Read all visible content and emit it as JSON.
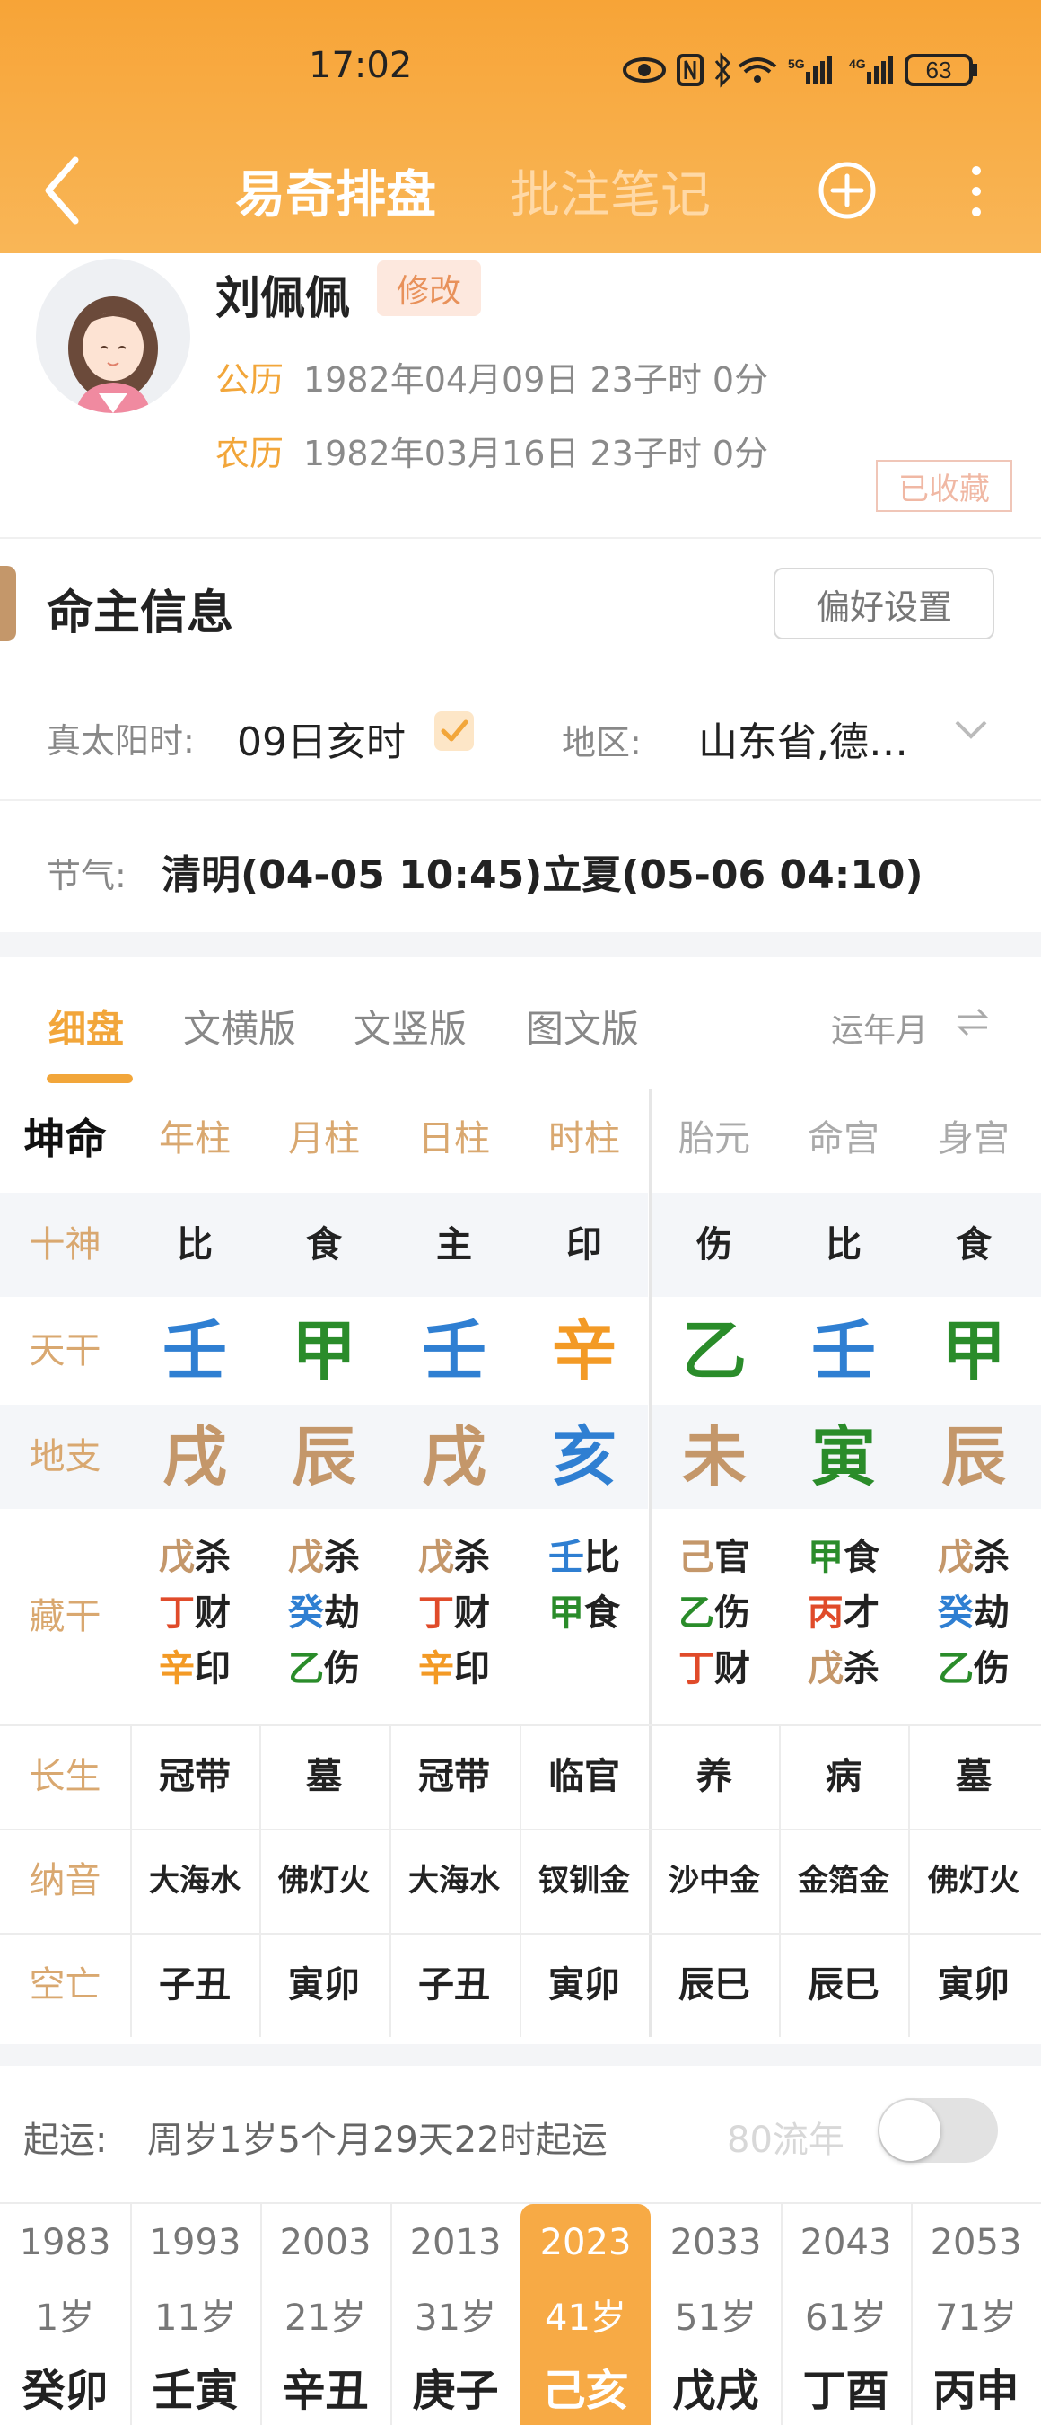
{
  "status": {
    "time": "17:02",
    "net1": "5G",
    "net2": "4G",
    "battery": "63"
  },
  "header": {
    "tab_active": "易奇排盘",
    "tab_inactive": "批注笔记"
  },
  "profile": {
    "name": "刘佩佩",
    "edit": "修改",
    "solar_label": "公历",
    "solar_value": "1982年04月09日 23子时 0分",
    "lunar_label": "农历",
    "lunar_value": "1982年03月16日 23子时 0分",
    "stamp": "已收藏"
  },
  "info": {
    "title": "命主信息",
    "pref_button": "偏好设置",
    "sun_label": "真太阳时:",
    "sun_value": "09日亥时",
    "region_label": "地区:",
    "region_value": "山东省,德…",
    "jieqi_label": "节气:",
    "jieqi_value": "清明(04-05 10:45)立夏(05-06 04:10)"
  },
  "tabs": [
    "细盘",
    "文横版",
    "文竖版",
    "图文版"
  ],
  "tab_right": "运年月",
  "chart": {
    "head": [
      "坤命",
      "年柱",
      "月柱",
      "日柱",
      "时柱",
      "胎元",
      "命宫",
      "身宫"
    ],
    "labels": {
      "shishen": "十神",
      "tiangan": "天干",
      "dizhi": "地支",
      "canggan": "藏干",
      "changsheng": "长生",
      "nayin": "纳音",
      "kongwang": "空亡"
    },
    "shishen": [
      "比",
      "食",
      "主",
      "印",
      "伤",
      "比",
      "食"
    ],
    "tiangan": [
      "壬",
      "甲",
      "壬",
      "辛",
      "乙",
      "壬",
      "甲"
    ],
    "tiangan_colors": [
      "#2f7fd2",
      "#2a8c2a",
      "#2f7fd2",
      "#f39a25",
      "#2a8c2a",
      "#2f7fd2",
      "#2a8c2a"
    ],
    "dizhi": [
      "戌",
      "辰",
      "戌",
      "亥",
      "未",
      "寅",
      "辰"
    ],
    "dizhi_colors": [
      "#c4976a",
      "#c4976a",
      "#c4976a",
      "#2f7fd2",
      "#c4976a",
      "#2a8c2a",
      "#c4976a"
    ],
    "canggan": [
      [
        [
          "戊",
          "杀"
        ],
        [
          "丁",
          "财"
        ],
        [
          "辛",
          "印"
        ]
      ],
      [
        [
          "戊",
          "杀"
        ],
        [
          "癸",
          "劫"
        ],
        [
          "乙",
          "伤"
        ]
      ],
      [
        [
          "戊",
          "杀"
        ],
        [
          "丁",
          "财"
        ],
        [
          "辛",
          "印"
        ]
      ],
      [
        [
          "壬",
          "比"
        ],
        [
          "甲",
          "食"
        ]
      ],
      [
        [
          "己",
          "官"
        ],
        [
          "乙",
          "伤"
        ],
        [
          "丁",
          "财"
        ]
      ],
      [
        [
          "甲",
          "食"
        ],
        [
          "丙",
          "才"
        ],
        [
          "戊",
          "杀"
        ]
      ],
      [
        [
          "戊",
          "杀"
        ],
        [
          "癸",
          "劫"
        ],
        [
          "乙",
          "伤"
        ]
      ]
    ],
    "changsheng": [
      "冠带",
      "墓",
      "冠带",
      "临官",
      "养",
      "病",
      "墓"
    ],
    "nayin": [
      "大海水",
      "佛灯火",
      "大海水",
      "钗钏金",
      "沙中金",
      "金箔金",
      "佛灯火"
    ],
    "kongwang": [
      "子丑",
      "寅卯",
      "子丑",
      "寅卯",
      "辰巳",
      "辰巳",
      "寅卯"
    ]
  },
  "qiyun": {
    "label": "起运:",
    "value": "周岁1岁5个月29天22时起运",
    "liunian": "80流年"
  },
  "dayun": [
    {
      "year": "1983",
      "age": "1岁",
      "gz": "癸卯"
    },
    {
      "year": "1993",
      "age": "11岁",
      "gz": "壬寅"
    },
    {
      "year": "2003",
      "age": "21岁",
      "gz": "辛丑"
    },
    {
      "year": "2013",
      "age": "31岁",
      "gz": "庚子"
    },
    {
      "year": "2023",
      "age": "41岁",
      "gz": "己亥"
    },
    {
      "year": "2033",
      "age": "51岁",
      "gz": "戊戌"
    },
    {
      "year": "2043",
      "age": "61岁",
      "gz": "丁酉"
    },
    {
      "year": "2053",
      "age": "71岁",
      "gz": "丙申"
    }
  ]
}
